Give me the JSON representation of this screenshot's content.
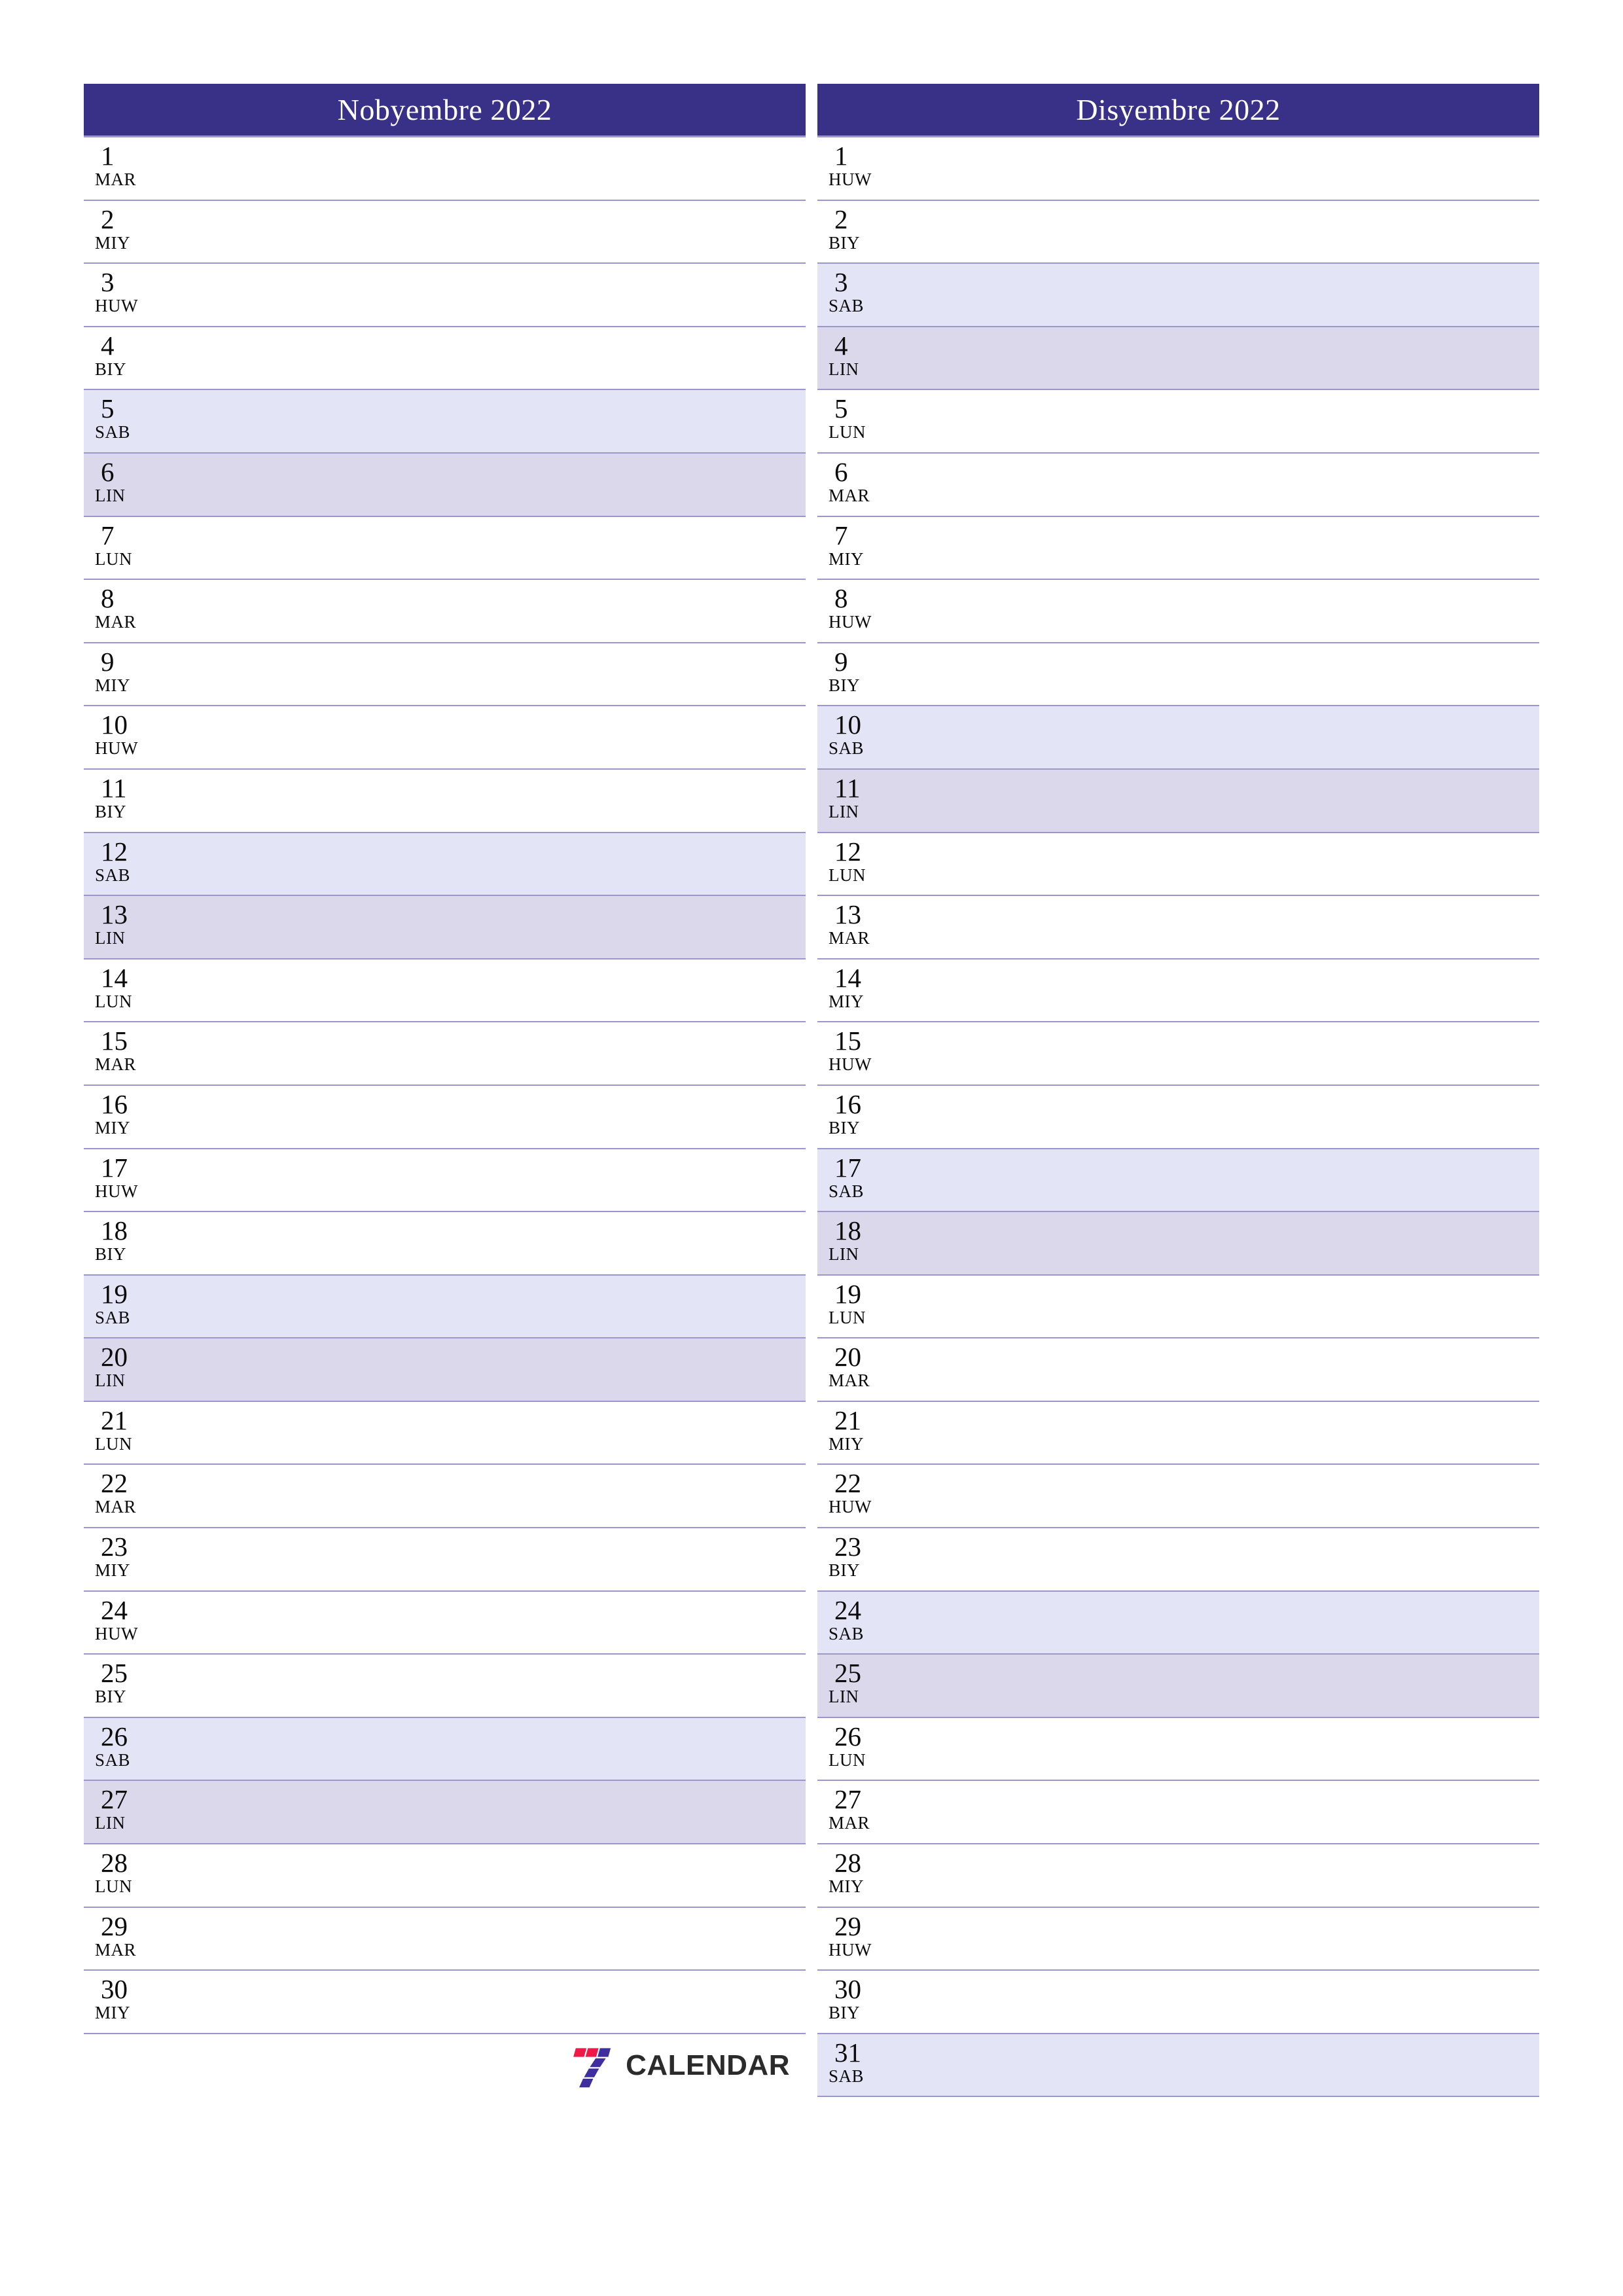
{
  "page": {
    "background": "#ffffff",
    "accent_header_color": "#393088",
    "rule_color": "#9b97cc",
    "saturday_color": "#e4e4f7",
    "sunday_color": "#dbd8ec"
  },
  "brand": {
    "name": "CALENDAR",
    "mark_icon": "seven-logo-icon",
    "mark_red": "#ef1846",
    "mark_purple": "#3f2f9e",
    "text_color": "#2b2b2b"
  },
  "months": [
    {
      "title": "Nobyembre 2022",
      "has_logo_row": true,
      "days": [
        {
          "num": "1",
          "abbr": "MAR",
          "type": "weekday"
        },
        {
          "num": "2",
          "abbr": "MIY",
          "type": "weekday"
        },
        {
          "num": "3",
          "abbr": "HUW",
          "type": "weekday"
        },
        {
          "num": "4",
          "abbr": "BIY",
          "type": "weekday"
        },
        {
          "num": "5",
          "abbr": "SAB",
          "type": "sat"
        },
        {
          "num": "6",
          "abbr": "LIN",
          "type": "sun"
        },
        {
          "num": "7",
          "abbr": "LUN",
          "type": "weekday"
        },
        {
          "num": "8",
          "abbr": "MAR",
          "type": "weekday"
        },
        {
          "num": "9",
          "abbr": "MIY",
          "type": "weekday"
        },
        {
          "num": "10",
          "abbr": "HUW",
          "type": "weekday"
        },
        {
          "num": "11",
          "abbr": "BIY",
          "type": "weekday"
        },
        {
          "num": "12",
          "abbr": "SAB",
          "type": "sat"
        },
        {
          "num": "13",
          "abbr": "LIN",
          "type": "sun"
        },
        {
          "num": "14",
          "abbr": "LUN",
          "type": "weekday"
        },
        {
          "num": "15",
          "abbr": "MAR",
          "type": "weekday"
        },
        {
          "num": "16",
          "abbr": "MIY",
          "type": "weekday"
        },
        {
          "num": "17",
          "abbr": "HUW",
          "type": "weekday"
        },
        {
          "num": "18",
          "abbr": "BIY",
          "type": "weekday"
        },
        {
          "num": "19",
          "abbr": "SAB",
          "type": "sat"
        },
        {
          "num": "20",
          "abbr": "LIN",
          "type": "sun"
        },
        {
          "num": "21",
          "abbr": "LUN",
          "type": "weekday"
        },
        {
          "num": "22",
          "abbr": "MAR",
          "type": "weekday"
        },
        {
          "num": "23",
          "abbr": "MIY",
          "type": "weekday"
        },
        {
          "num": "24",
          "abbr": "HUW",
          "type": "weekday"
        },
        {
          "num": "25",
          "abbr": "BIY",
          "type": "weekday"
        },
        {
          "num": "26",
          "abbr": "SAB",
          "type": "sat"
        },
        {
          "num": "27",
          "abbr": "LIN",
          "type": "sun"
        },
        {
          "num": "28",
          "abbr": "LUN",
          "type": "weekday"
        },
        {
          "num": "29",
          "abbr": "MAR",
          "type": "weekday"
        },
        {
          "num": "30",
          "abbr": "MIY",
          "type": "weekday"
        }
      ]
    },
    {
      "title": "Disyembre 2022",
      "has_logo_row": false,
      "days": [
        {
          "num": "1",
          "abbr": "HUW",
          "type": "weekday"
        },
        {
          "num": "2",
          "abbr": "BIY",
          "type": "weekday"
        },
        {
          "num": "3",
          "abbr": "SAB",
          "type": "sat"
        },
        {
          "num": "4",
          "abbr": "LIN",
          "type": "sun"
        },
        {
          "num": "5",
          "abbr": "LUN",
          "type": "weekday"
        },
        {
          "num": "6",
          "abbr": "MAR",
          "type": "weekday"
        },
        {
          "num": "7",
          "abbr": "MIY",
          "type": "weekday"
        },
        {
          "num": "8",
          "abbr": "HUW",
          "type": "weekday"
        },
        {
          "num": "9",
          "abbr": "BIY",
          "type": "weekday"
        },
        {
          "num": "10",
          "abbr": "SAB",
          "type": "sat"
        },
        {
          "num": "11",
          "abbr": "LIN",
          "type": "sun"
        },
        {
          "num": "12",
          "abbr": "LUN",
          "type": "weekday"
        },
        {
          "num": "13",
          "abbr": "MAR",
          "type": "weekday"
        },
        {
          "num": "14",
          "abbr": "MIY",
          "type": "weekday"
        },
        {
          "num": "15",
          "abbr": "HUW",
          "type": "weekday"
        },
        {
          "num": "16",
          "abbr": "BIY",
          "type": "weekday"
        },
        {
          "num": "17",
          "abbr": "SAB",
          "type": "sat"
        },
        {
          "num": "18",
          "abbr": "LIN",
          "type": "sun"
        },
        {
          "num": "19",
          "abbr": "LUN",
          "type": "weekday"
        },
        {
          "num": "20",
          "abbr": "MAR",
          "type": "weekday"
        },
        {
          "num": "21",
          "abbr": "MIY",
          "type": "weekday"
        },
        {
          "num": "22",
          "abbr": "HUW",
          "type": "weekday"
        },
        {
          "num": "23",
          "abbr": "BIY",
          "type": "weekday"
        },
        {
          "num": "24",
          "abbr": "SAB",
          "type": "sat"
        },
        {
          "num": "25",
          "abbr": "LIN",
          "type": "sun"
        },
        {
          "num": "26",
          "abbr": "LUN",
          "type": "weekday"
        },
        {
          "num": "27",
          "abbr": "MAR",
          "type": "weekday"
        },
        {
          "num": "28",
          "abbr": "MIY",
          "type": "weekday"
        },
        {
          "num": "29",
          "abbr": "HUW",
          "type": "weekday"
        },
        {
          "num": "30",
          "abbr": "BIY",
          "type": "weekday"
        },
        {
          "num": "31",
          "abbr": "SAB",
          "type": "sat"
        }
      ]
    }
  ]
}
